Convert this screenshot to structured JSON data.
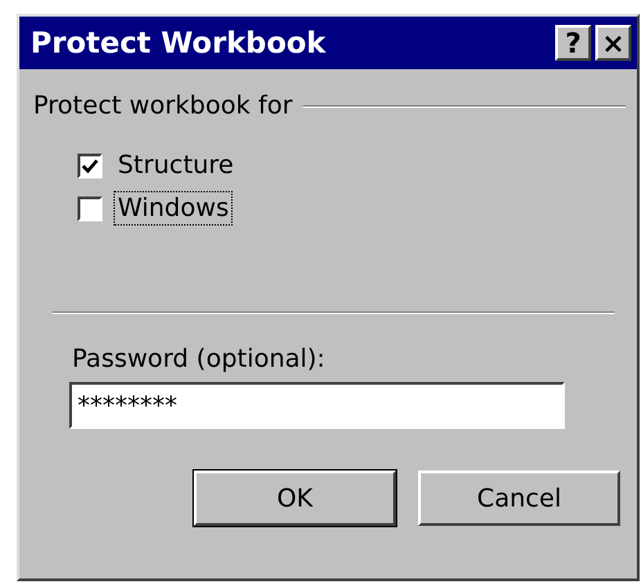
{
  "window": {
    "title": "Protect Workbook",
    "title_buttons": [
      "?",
      "×"
    ]
  },
  "group": {
    "label": "Protect workbook for"
  },
  "options": [
    {
      "label": "Structure",
      "checked": true,
      "focused": false
    },
    {
      "label": "Windows",
      "checked": false,
      "focused": true
    }
  ],
  "password": {
    "label": "Password (optional):",
    "value": "********"
  },
  "buttons": [
    {
      "label": "OK",
      "default": true
    },
    {
      "label": "Cancel",
      "default": false
    }
  ]
}
